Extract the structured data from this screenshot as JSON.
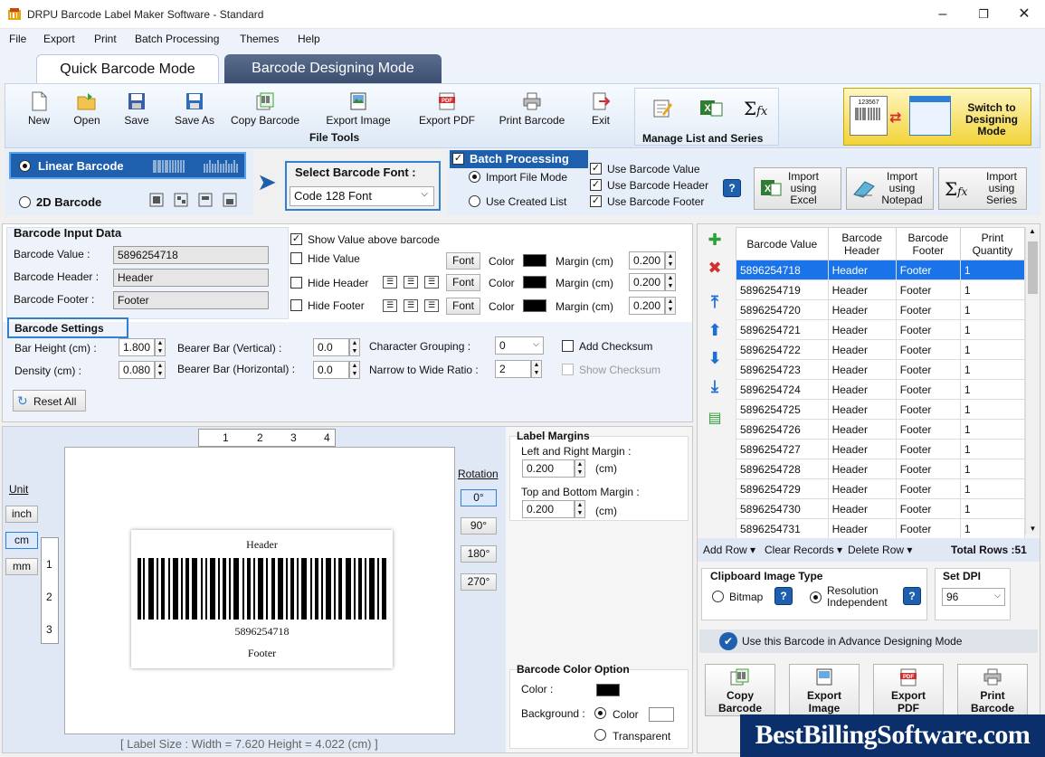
{
  "window": {
    "title": "DRPU Barcode Label Maker Software - Standard"
  },
  "menu": [
    "File",
    "Export",
    "Print",
    "Batch Processing",
    "Themes",
    "Help"
  ],
  "tabs": {
    "quick": "Quick Barcode Mode",
    "designing": "Barcode Designing Mode"
  },
  "toolbar": {
    "buttons": [
      "New",
      "Open",
      "Save",
      "Save As",
      "Copy Barcode",
      "Export Image",
      "Export PDF",
      "Print Barcode",
      "Exit"
    ],
    "file_tools_label": "File Tools",
    "manage_label": "Manage List and Series",
    "switch_label_1": "Switch to",
    "switch_label_2": "Designing",
    "switch_label_3": "Mode",
    "thumb_value": "123567"
  },
  "barcode_type": {
    "linear": "Linear Barcode",
    "twod": "2D Barcode"
  },
  "font_select": {
    "label": "Select Barcode Font :",
    "value": "Code 128 Font"
  },
  "batch": {
    "title": "Batch Processing",
    "import_file_mode": "Import File Mode",
    "use_created_list": "Use Created List",
    "use_value": "Use Barcode Value",
    "use_header": "Use Barcode Header",
    "use_footer": "Use Barcode Footer",
    "import_excel": [
      "Import",
      "using",
      "Excel"
    ],
    "import_notepad": [
      "Import",
      "using",
      "Notepad"
    ],
    "import_series": [
      "Import",
      "using",
      "Series"
    ]
  },
  "input_data": {
    "title": "Barcode Input Data",
    "value_label": "Barcode Value :",
    "value": "5896254718",
    "header_label": "Barcode Header :",
    "header": "Header",
    "footer_label": "Barcode Footer :",
    "footer": "Footer",
    "show_value_above": "Show Value above barcode",
    "hide_value": "Hide Value",
    "hide_header": "Hide Header",
    "hide_footer": "Hide Footer",
    "font_btn": "Font",
    "color_label": "Color",
    "margin_label": "Margin (cm)",
    "margins": [
      "0.200",
      "0.200",
      "0.200"
    ]
  },
  "settings": {
    "title": "Barcode Settings",
    "bar_height_label": "Bar Height (cm) :",
    "bar_height": "1.800",
    "density_label": "Density (cm) :",
    "density": "0.080",
    "bearer_v_label": "Bearer Bar (Vertical) :",
    "bearer_v": "0.0",
    "bearer_h_label": "Bearer Bar (Horizontal) :",
    "bearer_h": "0.0",
    "char_group_label": "Character Grouping :",
    "char_group": "0",
    "ratio_label": "Narrow to Wide Ratio :",
    "ratio": "2",
    "add_checksum": "Add Checksum",
    "show_checksum": "Show Checksum",
    "reset": "Reset All"
  },
  "preview": {
    "ruler": [
      "1",
      "2",
      "3",
      "4"
    ],
    "vruler": [
      "1",
      "2",
      "3"
    ],
    "unit_label": "Unit",
    "units": [
      "inch",
      "cm",
      "mm"
    ],
    "rotation_label": "Rotation",
    "rotations": [
      "0°",
      "90°",
      "180°",
      "270°"
    ],
    "header": "Header",
    "value": "5896254718",
    "footer": "Footer",
    "label_size": "[ Label Size : Width = 7.620  Height = 4.022 (cm) ]"
  },
  "margins": {
    "title": "Label Margins",
    "lr_label": "Left and Right Margin :",
    "lr": "0.200",
    "tb_label": "Top and Bottom Margin :",
    "tb": "0.200",
    "unit": "(cm)"
  },
  "color_option": {
    "title": "Barcode Color Option",
    "color_label": "Color :",
    "background_label": "Background :",
    "color_opt": "Color",
    "transparent_opt": "Transparent"
  },
  "grid": {
    "headers": [
      "Barcode Value",
      "Barcode Header",
      "Barcode Footer",
      "Print Quantity"
    ],
    "rows": [
      [
        "5896254718",
        "Header",
        "Footer",
        "1"
      ],
      [
        "5896254719",
        "Header",
        "Footer",
        "1"
      ],
      [
        "5896254720",
        "Header",
        "Footer",
        "1"
      ],
      [
        "5896254721",
        "Header",
        "Footer",
        "1"
      ],
      [
        "5896254722",
        "Header",
        "Footer",
        "1"
      ],
      [
        "5896254723",
        "Header",
        "Footer",
        "1"
      ],
      [
        "5896254724",
        "Header",
        "Footer",
        "1"
      ],
      [
        "5896254725",
        "Header",
        "Footer",
        "1"
      ],
      [
        "5896254726",
        "Header",
        "Footer",
        "1"
      ],
      [
        "5896254727",
        "Header",
        "Footer",
        "1"
      ],
      [
        "5896254728",
        "Header",
        "Footer",
        "1"
      ],
      [
        "5896254729",
        "Header",
        "Footer",
        "1"
      ],
      [
        "5896254730",
        "Header",
        "Footer",
        "1"
      ],
      [
        "5896254731",
        "Header",
        "Footer",
        "1"
      ]
    ],
    "add_row": "Add Row",
    "clear_records": "Clear Records",
    "delete_row": "Delete Row",
    "total_rows": "Total Rows :51"
  },
  "clipboard": {
    "title": "Clipboard Image Type",
    "bitmap": "Bitmap",
    "resolution": "Resolution",
    "independent": "Independent",
    "dpi_title": "Set DPI",
    "dpi": "96"
  },
  "advance": "Use this Barcode in Advance Designing Mode",
  "bottom_buttons": [
    [
      "Copy",
      "Barcode"
    ],
    [
      "Export",
      "Image"
    ],
    [
      "Export",
      "PDF"
    ],
    [
      "Print",
      "Barcode"
    ]
  ],
  "watermark": "BestBillingSoftware.com",
  "colors": {
    "accent": "#2f7fd6",
    "selection": "#1a73e8",
    "watermark_bg": "#0a2f6b"
  }
}
